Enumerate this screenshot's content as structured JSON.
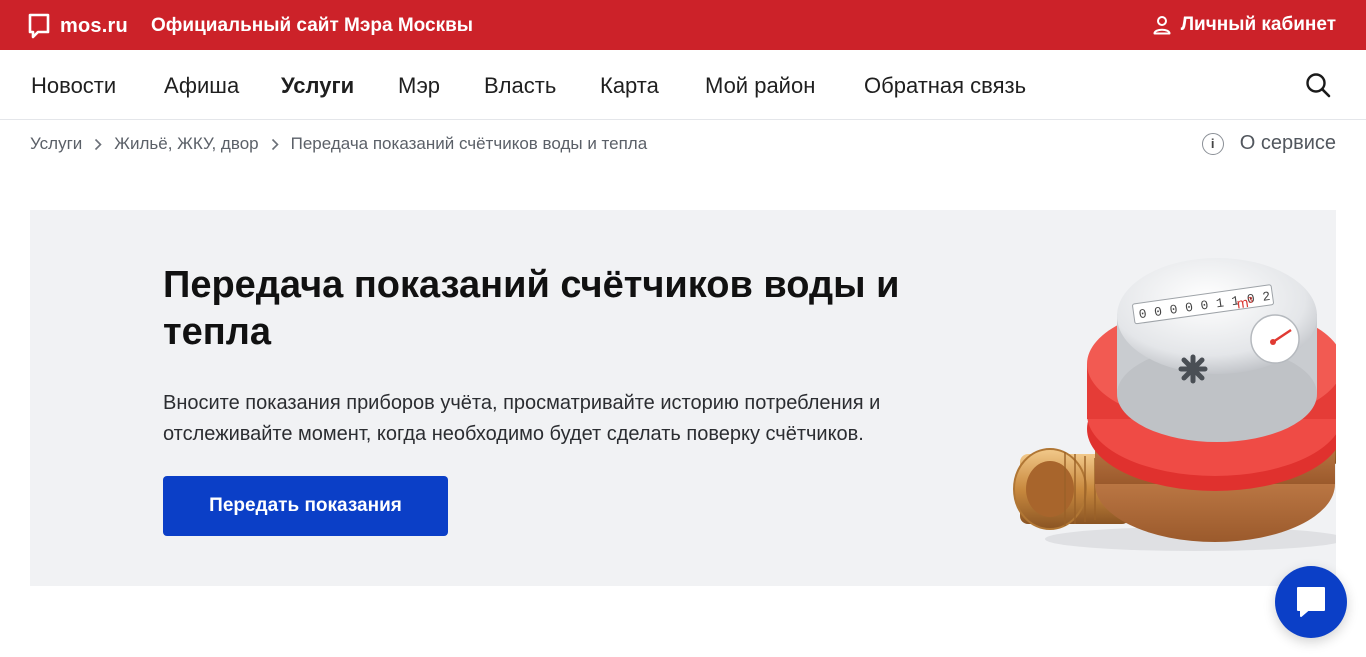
{
  "topbar": {
    "logo_text": "mos.ru",
    "site_title": "Официальный сайт Мэра Москвы",
    "cabinet_label": "Личный кабинет",
    "background": "#cc2229"
  },
  "nav": {
    "items": [
      {
        "label": "Новости",
        "active": false
      },
      {
        "label": "Афиша",
        "active": false
      },
      {
        "label": "Услуги",
        "active": true
      },
      {
        "label": "Мэр",
        "active": false
      },
      {
        "label": "Власть",
        "active": false
      },
      {
        "label": "Карта",
        "active": false
      },
      {
        "label": "Мой район",
        "active": false
      },
      {
        "label": "Обратная связь",
        "active": false
      }
    ],
    "search_icon": "search-icon"
  },
  "breadcrumb": {
    "items": [
      "Услуги",
      "Жильё, ЖКУ, двор",
      "Передача показаний счётчиков воды и тепла"
    ],
    "separator_icon": "chevron-right-icon"
  },
  "about": {
    "label": "О сервисе",
    "icon_glyph": "i"
  },
  "hero": {
    "title": "Передача показаний счётчиков воды и тепла",
    "description": "Вносите показания приборов учёта, просматривайте историю потребления и отслеживайте момент, когда необходимо будет сделать поверку счётчиков.",
    "button_label": "Передать показания",
    "button_color": "#0b3fc7",
    "background": "#f1f2f4",
    "image": "water-meter-image"
  },
  "chat": {
    "icon": "chat-icon",
    "color": "#0b3fc7"
  }
}
